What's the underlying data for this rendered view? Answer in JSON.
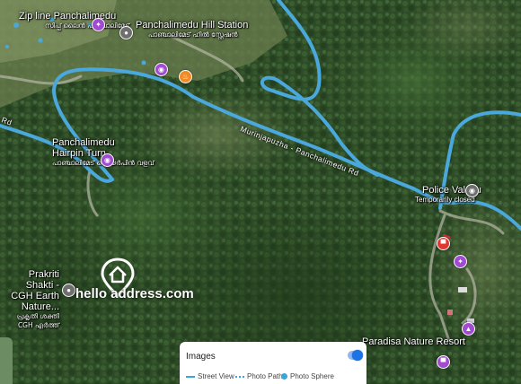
{
  "map": {
    "road_name": "Murinjapuzha - Panchalimedu Rd",
    "road_name_left": "Rd",
    "street_view_color": "#4aa8dc"
  },
  "places": [
    {
      "name": "Zip line Panchalimedu",
      "local": "സിപ്പ് ലൈൻ പാഞ്ചാലിമേട്",
      "icon": "activity-icon",
      "color": "#a04bd0"
    },
    {
      "name": "Panchalimedu Hill Station",
      "local": "പാഞ്ചാലിമേട് ഹിൽ സ്റ്റേഷൻ",
      "icon": "pin-icon",
      "color": "#6f6f6f"
    },
    {
      "name": "Panchalimedu Hairpin Turn",
      "local": "പാഞ്ചാലിമേട് ഹെയർപിൻ വളവ്",
      "icon": "camera-icon",
      "color": "#a04bd0"
    },
    {
      "name": "Police Valavu",
      "local": "Temporarily closed",
      "icon": "camera-icon",
      "color": "#6f6f6f"
    },
    {
      "name": "Prakriti Shakti - CGH Earth Nature...",
      "local": "പ്രകൃതി ശക്തി CGH എർത്ത്",
      "icon": "pin-icon",
      "color": "#6f6f6f"
    },
    {
      "name": "Paradisa Nature Resort",
      "local": "",
      "icon": "hotel-icon",
      "color": "#a04bd0"
    }
  ],
  "watermark": {
    "text": "hello address.com"
  },
  "legend": {
    "title": "Images",
    "items": [
      "Street View",
      "Photo Path",
      "Photo Sphere"
    ],
    "toggle_on": true
  }
}
